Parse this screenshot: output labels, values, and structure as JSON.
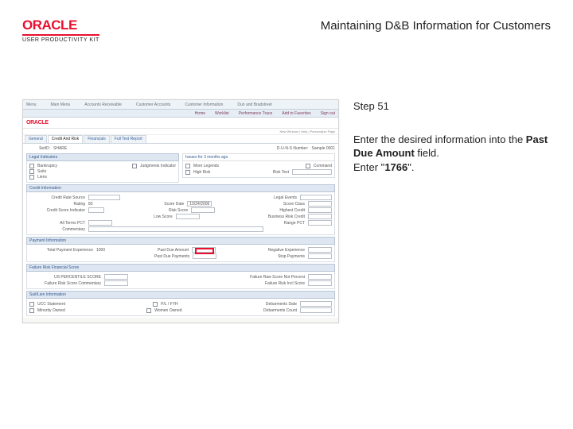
{
  "header": {
    "logo_text": "ORACLE",
    "logo_sub": "USER PRODUCTIVITY KIT",
    "doc_title": "Maintaining D&B Information for Customers"
  },
  "instruction": {
    "step_label": "Step 51",
    "line1": "Enter the desired information into the ",
    "field_name": "Past Due Amount",
    "line2": " field.",
    "line3_prefix": "Enter \"",
    "value": "1766",
    "line3_suffix": "\"."
  },
  "screenshot": {
    "topmenu": [
      "Menu",
      "Main Menu",
      "Accounts Receivable",
      "Customer Accounts",
      "Customer Information",
      "Dun and Bradstreet"
    ],
    "submenu": [
      "Home",
      "Worklist",
      "Performance Trace",
      "Add to Favorites",
      "Sign out"
    ],
    "logo": "ORACLE",
    "crumb": "New Window | Help | Personalize Page",
    "tabs": [
      "General",
      "Credit And Risk",
      "Financials",
      "Full Text Report"
    ],
    "active_tab": 1,
    "setid": {
      "label": "SetID:",
      "value": "SHARE"
    },
    "dnb": {
      "label": "D-U-N-S Number:",
      "value": "Sample 0001"
    },
    "indicators_section": "Legal Indicators",
    "indicators": [
      [
        "Bankruptcy",
        "Judgments Indicator"
      ],
      [
        "Suits",
        ""
      ],
      [
        "Liens",
        ""
      ]
    ],
    "payments_section": "Payment Information",
    "payments_right_lbl": "Issues for 3 months ago",
    "payments_cols": [
      "More Legends",
      "Command",
      ""
    ],
    "credit_section": "Credit Information",
    "credit_rows": [
      [
        "Credit Rate Source",
        "",
        "Legal Events",
        ""
      ],
      [
        "Rating",
        "83",
        "Score Date",
        "10/24/2006",
        "Score Class",
        ""
      ],
      [
        "Credit Score Indicator",
        "",
        "Risk Score",
        "",
        "Highest Credit",
        ""
      ],
      [
        "",
        "",
        "Low Score",
        "",
        "Business Risk Credit",
        ""
      ],
      [
        "All Terms PCT",
        "",
        "Range PCT",
        "",
        "",
        ""
      ],
      [
        "Commentary",
        "",
        "",
        "",
        "",
        ""
      ]
    ],
    "payment_info_section": "Payment Information",
    "payment_info_rows": [
      [
        "Total Payment Experience",
        "1000",
        "Past Due Amount",
        "",
        "Negative Experience",
        ""
      ],
      [
        "",
        "",
        "Past Due Payments",
        "",
        "Stop Payments",
        ""
      ]
    ],
    "failure_section": "Failure Risk Financial Score",
    "failure_rows": [
      [
        "US PERCENTILE SCORE",
        "",
        "Failure Raw Score Not Percent",
        ""
      ],
      [
        "Failure Risk Score Commentary",
        "",
        "Failure Risk Incl Score",
        ""
      ]
    ],
    "suit_section": "Suit/Lien Information",
    "suit_rows": [
      [
        "UCC Statement",
        "P/L / FYH",
        "Debarments Date",
        ""
      ],
      [
        "Minority Owned",
        "Women Owned",
        "Debarments Count",
        ""
      ]
    ]
  }
}
